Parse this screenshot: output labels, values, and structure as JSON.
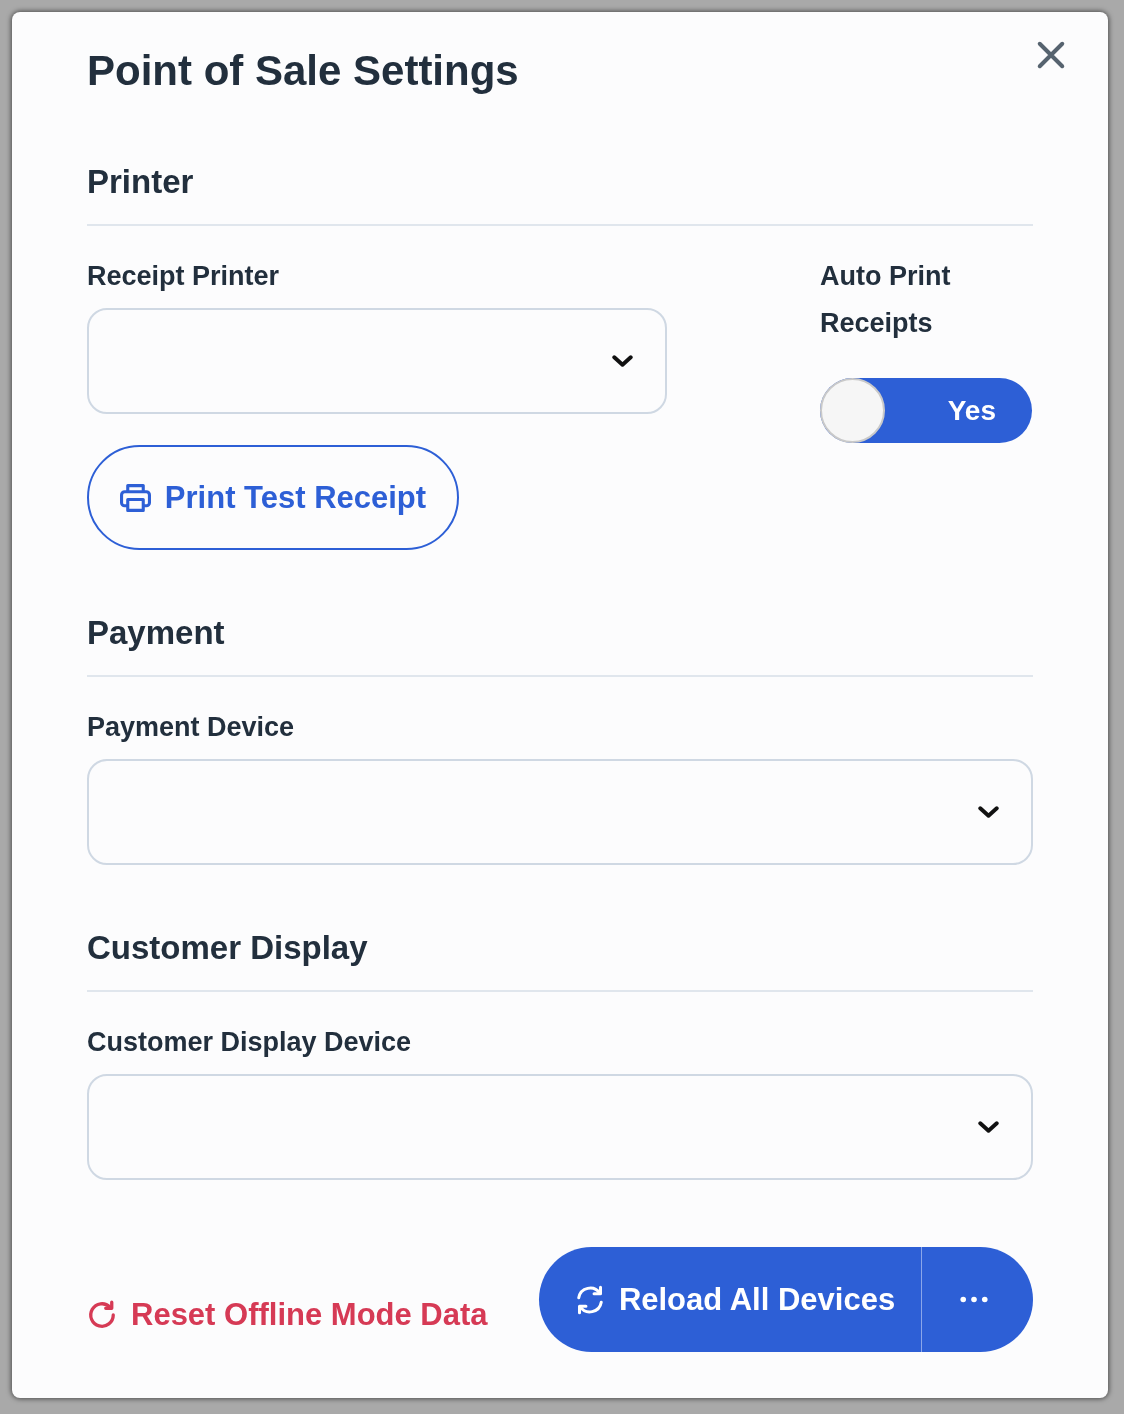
{
  "dialog": {
    "title": "Point of Sale Settings"
  },
  "sections": [
    {
      "heading": "Printer",
      "select_label": "Receipt Printer",
      "toggle": {
        "label": "Auto Print Receipts",
        "value": "Yes",
        "on": true
      },
      "action_button": "Print Test Receipt"
    },
    {
      "heading": "Payment",
      "select_label": "Payment Device"
    },
    {
      "heading": "Customer Display",
      "select_label": "Customer Display Device"
    }
  ],
  "footer": {
    "reset_link": "Reset Offline Mode Data",
    "primary_button": "Reload All Devices"
  }
}
